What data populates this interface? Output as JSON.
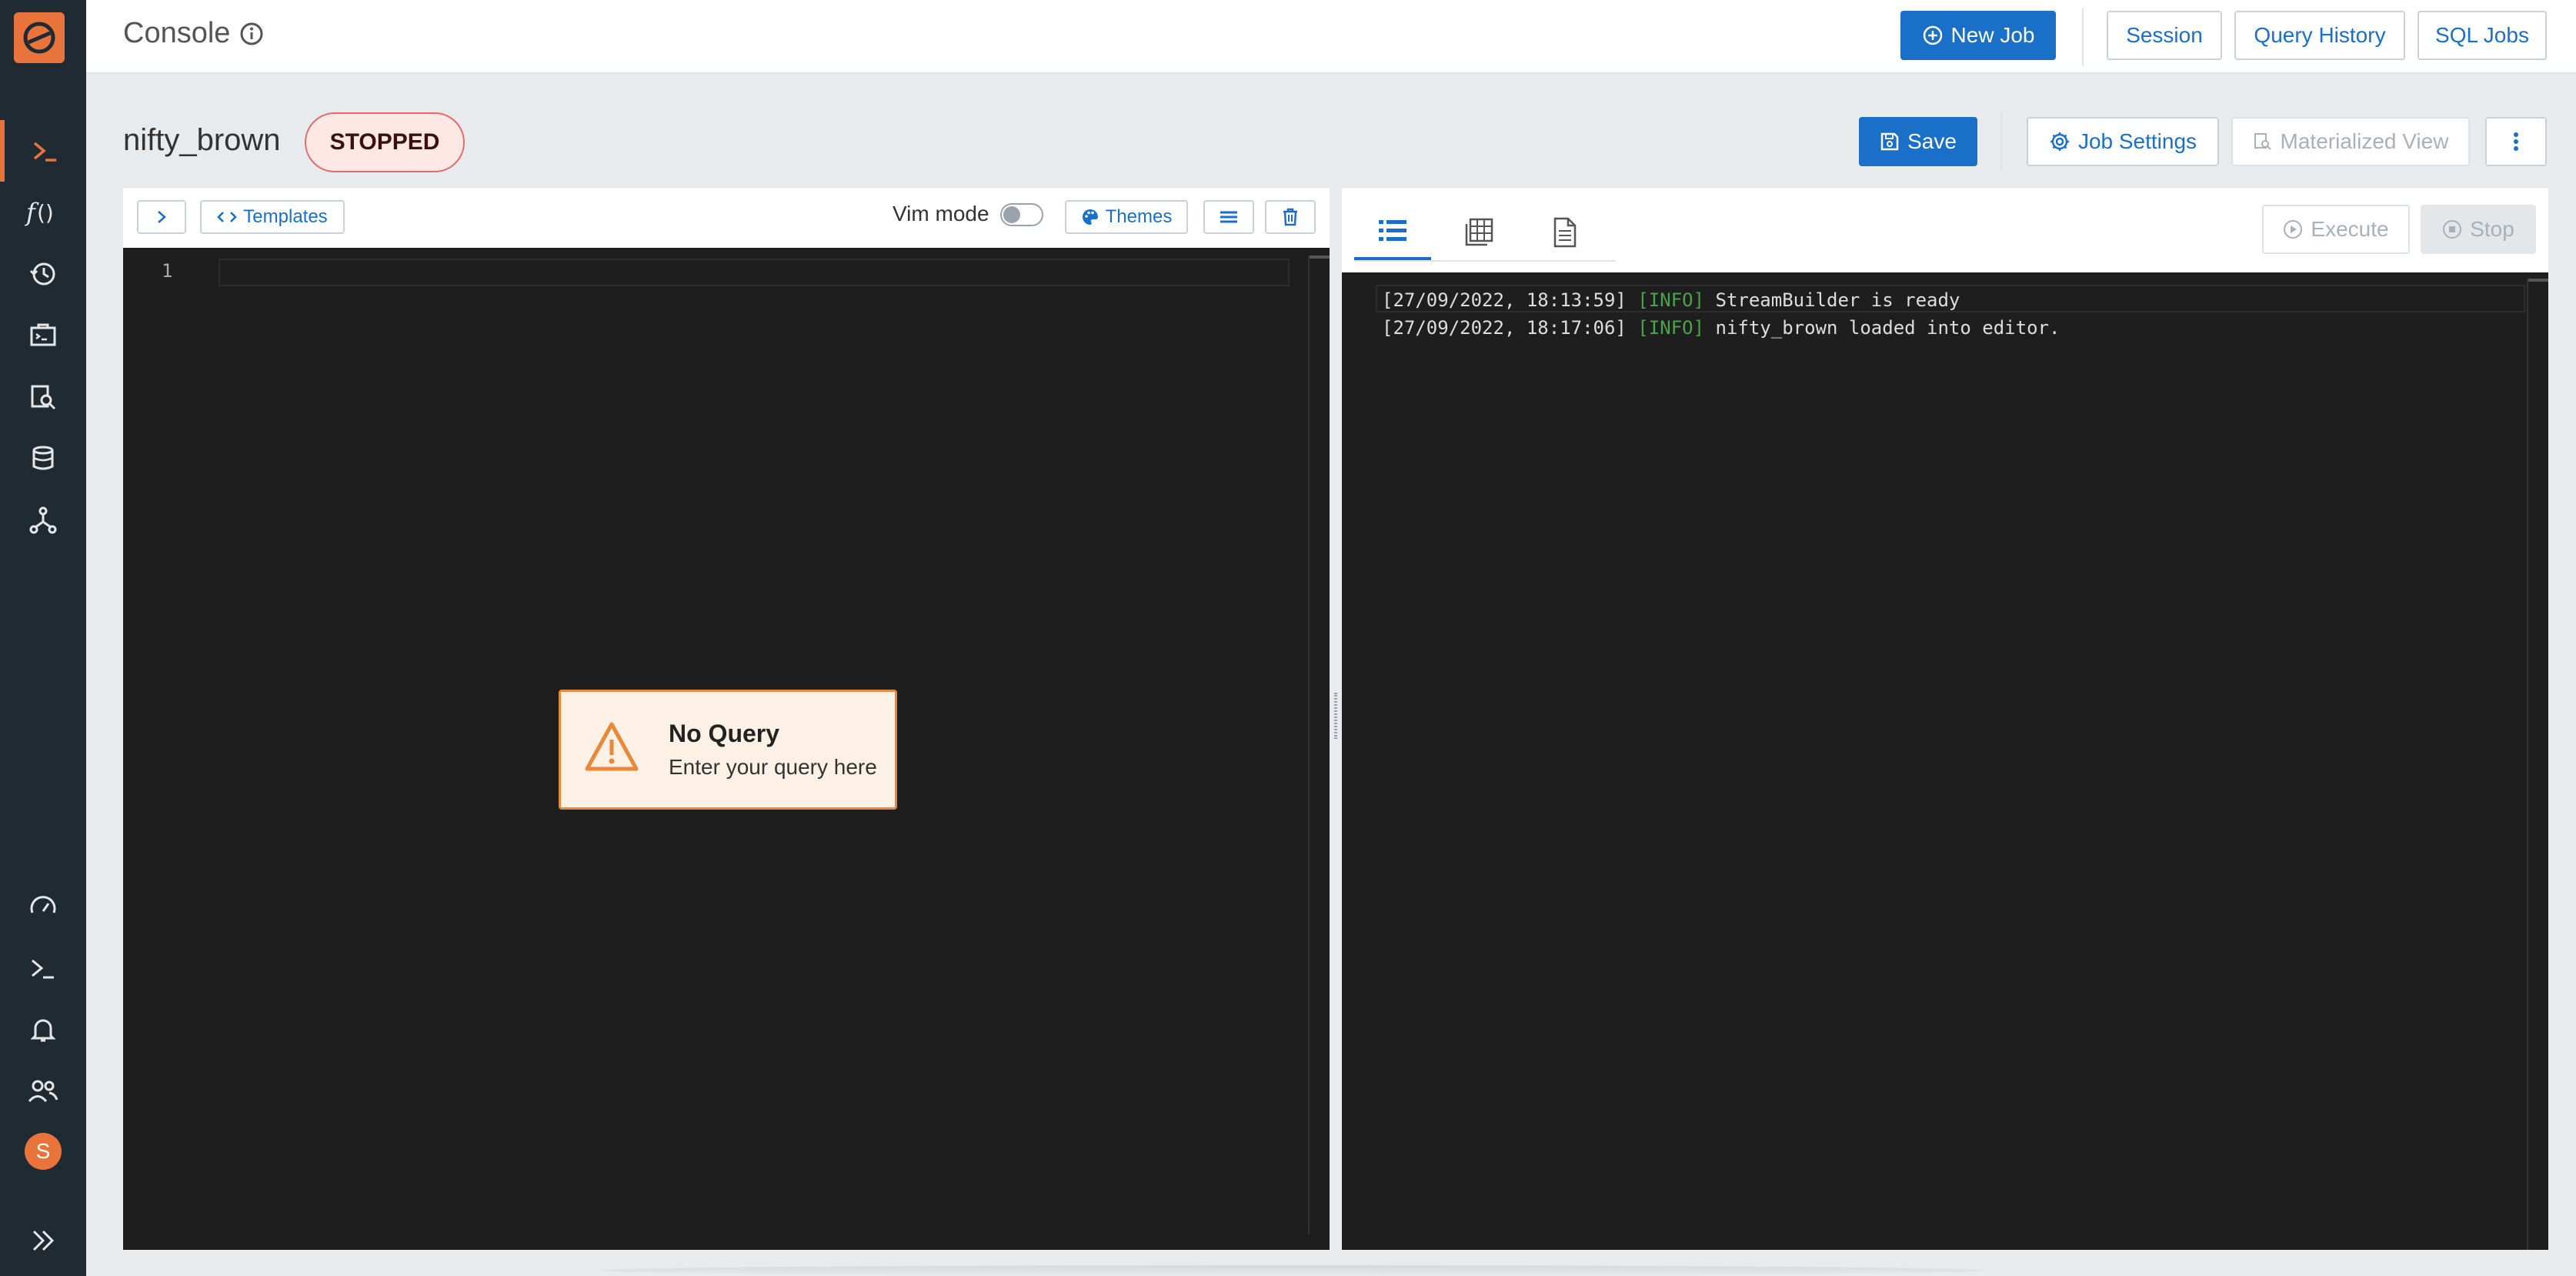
{
  "header": {
    "title": "Console",
    "new_job_label": "New Job",
    "session_label": "Session",
    "query_history_label": "Query History",
    "sql_jobs_label": "SQL Jobs"
  },
  "job": {
    "name": "nifty_brown",
    "status": "STOPPED",
    "save_label": "Save",
    "job_settings_label": "Job Settings",
    "materialized_view_label": "Materialized View"
  },
  "editor": {
    "templates_label": "Templates",
    "vim_mode_label": "Vim mode",
    "vim_mode_on": false,
    "themes_label": "Themes",
    "line_number": "1",
    "no_query_title": "No Query",
    "no_query_message": "Enter your query here"
  },
  "results": {
    "execute_label": "Execute",
    "stop_label": "Stop",
    "logs": [
      {
        "timestamp": "[27/09/2022, 18:13:59]",
        "level": "[INFO]",
        "message": "StreamBuilder is ready"
      },
      {
        "timestamp": "[27/09/2022, 18:17:06]",
        "level": "[INFO]",
        "message": "nifty_brown loaded into editor."
      }
    ]
  },
  "sidebar": {
    "avatar_initial": "S",
    "items": [
      "console-icon",
      "function-icon",
      "history-icon",
      "jobs-icon",
      "data-search-icon",
      "database-icon",
      "graph-icon",
      "gauge-icon",
      "terminal-icon",
      "bell-icon",
      "users-icon",
      "avatar",
      "expand-icon"
    ]
  },
  "colors": {
    "brand": "#e8743b",
    "primary": "#1a6fc8",
    "sidebar_bg": "#1f2a33",
    "editor_bg": "#1e1e1e",
    "status_stopped": "#e26a6a",
    "log_info": "#4aa34a"
  }
}
